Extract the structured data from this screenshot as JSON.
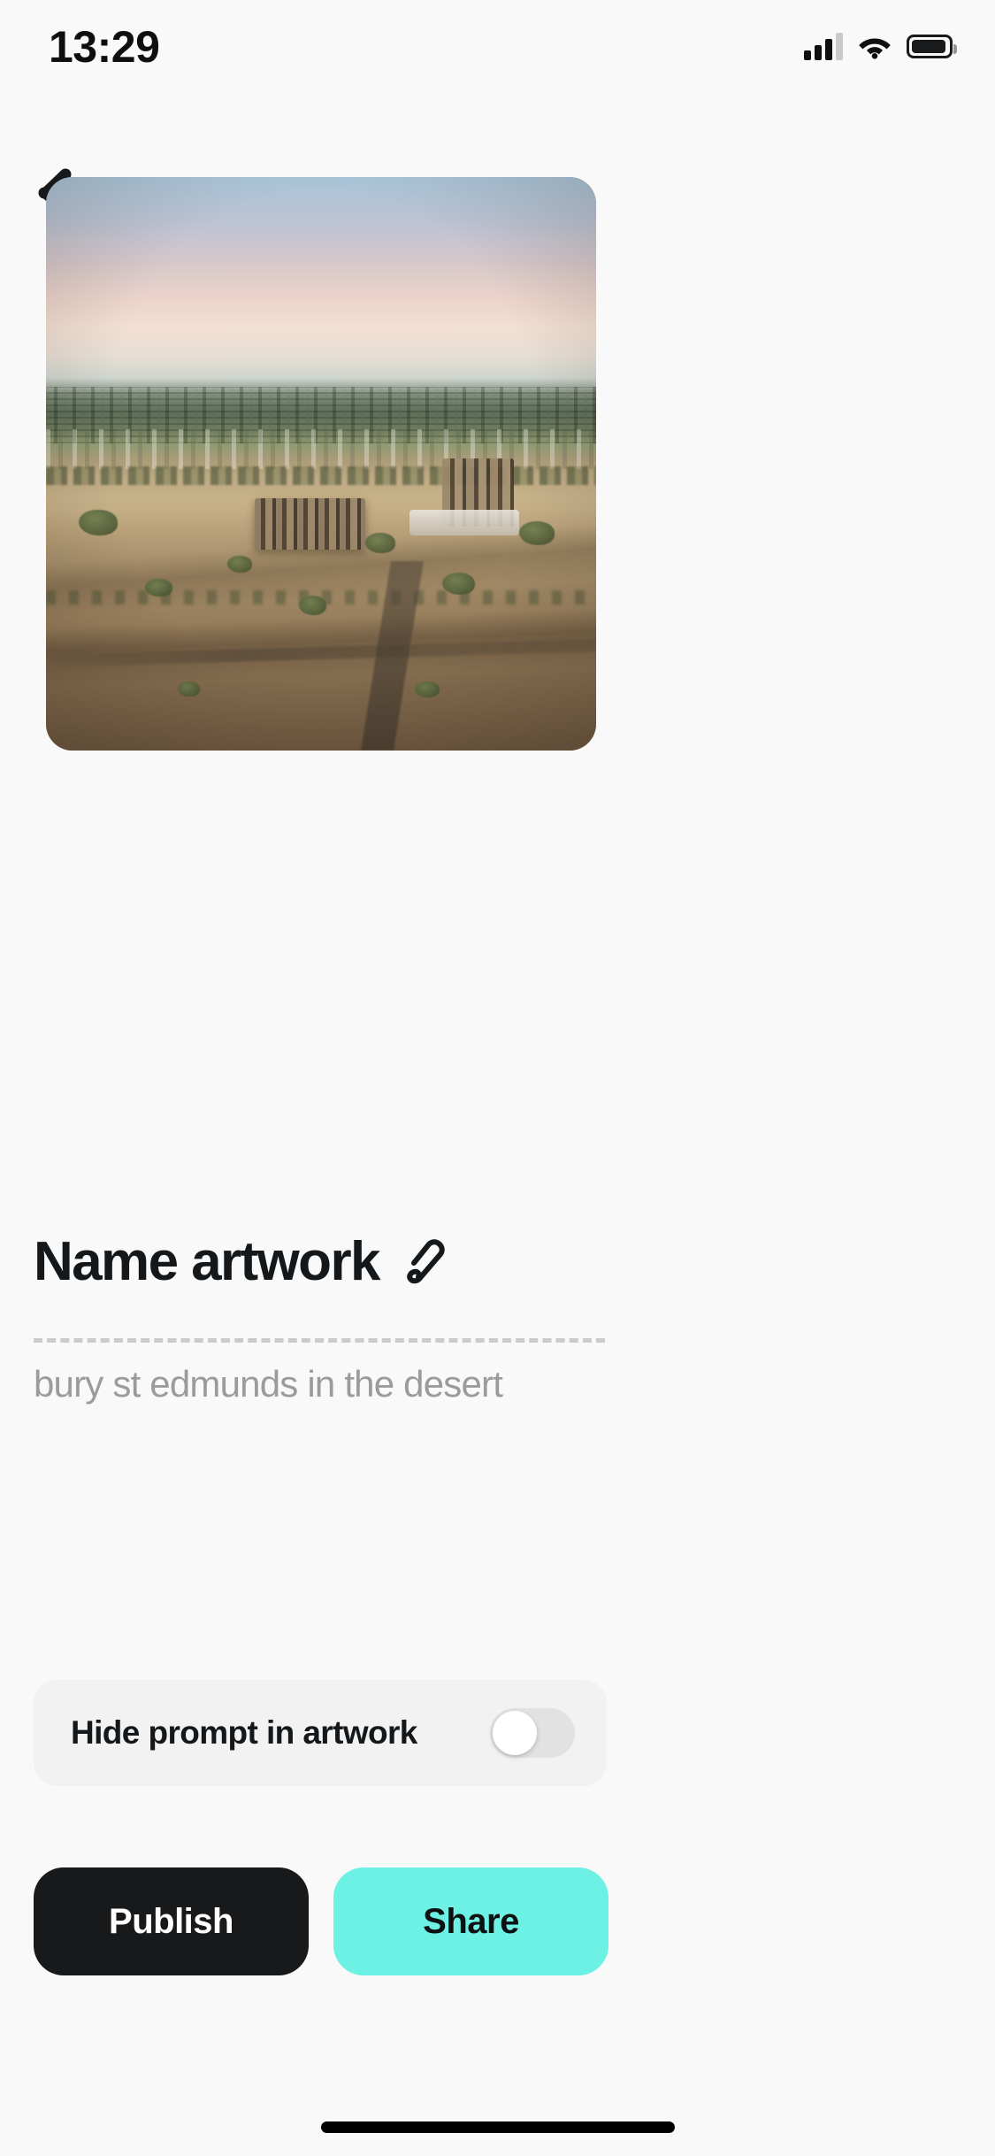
{
  "status_bar": {
    "time": "13:29",
    "icons": [
      "cellular-signal-icon",
      "wifi-icon",
      "battery-icon"
    ]
  },
  "nav": {
    "back_icon": "arrow-left-icon"
  },
  "artwork": {
    "alt": "Aerial view of a sun-baked desert landscape with abbey ruins and a distant town on the horizon",
    "regenerate_icon": "refresh-icon",
    "download_icon": "download-icon",
    "like_icon": "thumbs-up-icon",
    "page_indicators": [
      "light",
      "dark"
    ]
  },
  "title_section": {
    "title": "Name artwork",
    "edit_icon": "pencil-icon",
    "prompt": "bury st edmunds in the desert"
  },
  "settings": {
    "hide_prompt_label": "Hide prompt in artwork",
    "hide_prompt_value": "off"
  },
  "actions": {
    "publish_label": "Publish",
    "share_label": "Share"
  },
  "colors": {
    "background": "#F9F9F9",
    "ink": "#14181A",
    "muted": "#9B9B9B",
    "accent_mint": "#6EF1E5",
    "publish_black": "#17191A",
    "toggle_track_off": "#E2E2E2",
    "card_surface": "#F2F2F2"
  }
}
